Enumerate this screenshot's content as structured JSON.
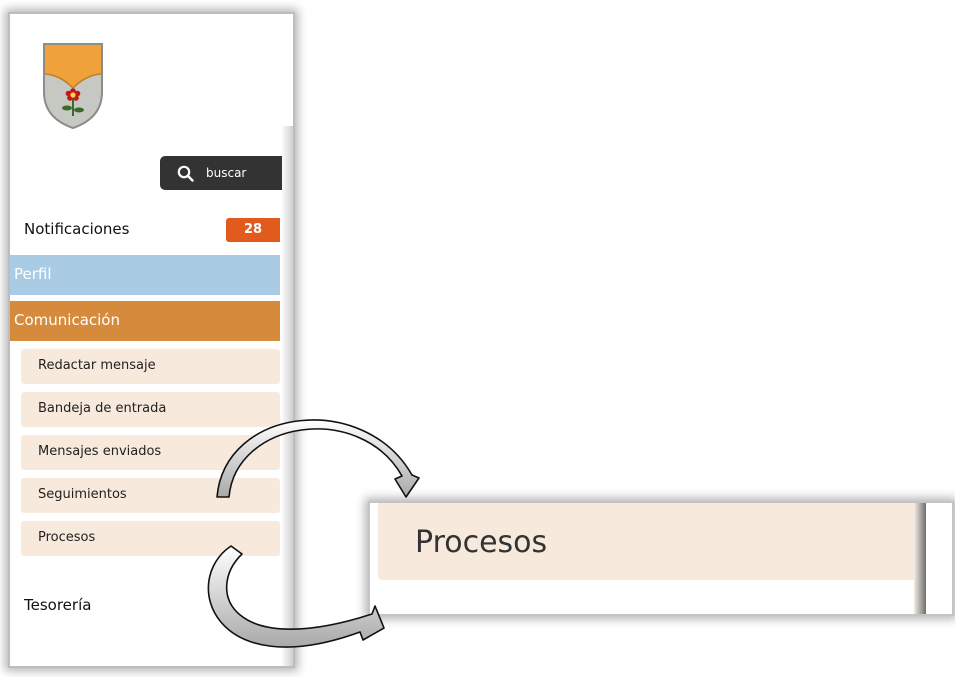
{
  "sidebar": {
    "search_label": "buscar",
    "notifications": {
      "label": "Notificaciones",
      "count": "28"
    },
    "perfil": {
      "label": "Perfil"
    },
    "comunicacion": {
      "label": "Comunicación",
      "items": [
        {
          "label": "Redactar mensaje"
        },
        {
          "label": "Bandeja de entrada"
        },
        {
          "label": "Mensajes enviados"
        },
        {
          "label": "Seguimientos"
        },
        {
          "label": "Procesos"
        }
      ]
    },
    "tesoreria": {
      "label": "Tesorería"
    }
  },
  "zoom": {
    "label": "Procesos"
  },
  "icons": [
    "crest-logo",
    "search-icon",
    "curved-arrow-icon"
  ],
  "colors": {
    "badge": "#e15b1e",
    "perfil_bg": "#a9cce4",
    "comunicacion_bg": "#d68a3c",
    "submenu_bg": "#f7e9dc",
    "search_bg": "#333333"
  }
}
